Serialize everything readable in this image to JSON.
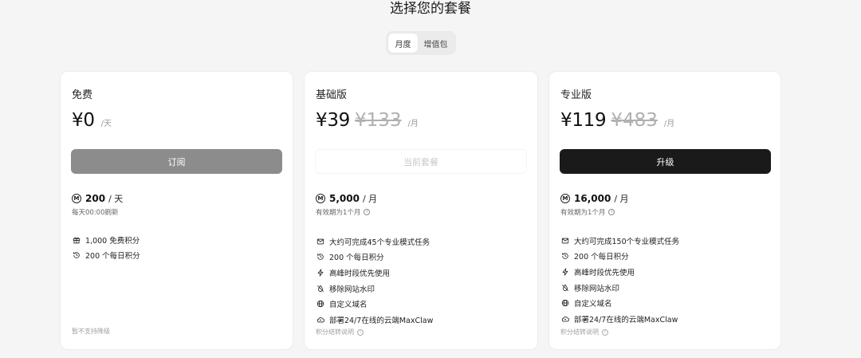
{
  "page": {
    "title": "选择您的套餐"
  },
  "billing_toggle": {
    "monthly": "月度",
    "addon": "增值包",
    "selected": "月度"
  },
  "plans": [
    {
      "name": "免费",
      "price": "¥0",
      "per": "/天",
      "button": "订阅",
      "credits": {
        "amount": "200",
        "unit": "/ 天",
        "sub": "每天00:00刷新"
      },
      "features": [
        {
          "icon": "gift-icon",
          "text": "1,000 免费积分"
        },
        {
          "icon": "refresh-icon",
          "text": "200 个每日积分"
        }
      ],
      "footer": "暂不支持降级"
    },
    {
      "name": "基础版",
      "price": "¥39",
      "old_price": "¥133",
      "per": "/月",
      "button": "当前套餐",
      "credits": {
        "amount": "5,000",
        "unit": "/ 月",
        "sub": "有效期为1个月"
      },
      "features": [
        {
          "icon": "mail-icon",
          "text": "大约可完成45个专业模式任务"
        },
        {
          "icon": "refresh-icon",
          "text": "200 个每日积分"
        },
        {
          "icon": "lightning-icon",
          "text": "高峰时段优先使用"
        },
        {
          "icon": "no-watermark-icon",
          "text": "移除网站水印"
        },
        {
          "icon": "globe-icon",
          "text": "自定义域名"
        },
        {
          "icon": "cloud-deploy-icon",
          "text": "部署24/7在线的云端MaxClaw"
        }
      ],
      "footer": "积分结转说明"
    },
    {
      "name": "专业版",
      "price": "¥119",
      "old_price": "¥483",
      "per": "/月",
      "button": "升级",
      "credits": {
        "amount": "16,000",
        "unit": "/ 月",
        "sub": "有效期为1个月"
      },
      "features": [
        {
          "icon": "mail-icon",
          "text": "大约可完成150个专业模式任务"
        },
        {
          "icon": "refresh-icon",
          "text": "200 个每日积分"
        },
        {
          "icon": "lightning-icon",
          "text": "高峰时段优先使用"
        },
        {
          "icon": "no-watermark-icon",
          "text": "移除网站水印"
        },
        {
          "icon": "globe-icon",
          "text": "自定义域名"
        },
        {
          "icon": "cloud-deploy-icon",
          "text": "部署24/7在线的云端MaxClaw"
        }
      ],
      "footer": "积分结转说明"
    }
  ],
  "credit_icon_glyph": "M",
  "info_icon_glyph": "i"
}
